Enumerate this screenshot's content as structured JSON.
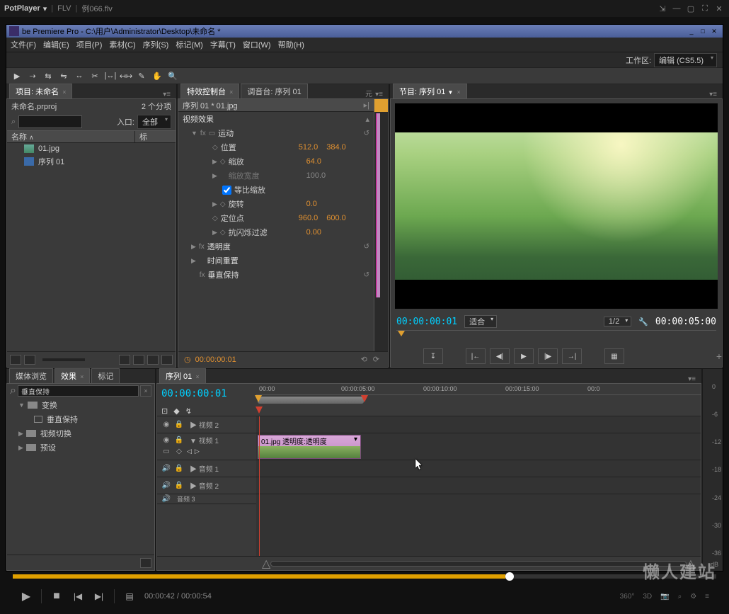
{
  "potplayer": {
    "app": "PotPlayer",
    "dropdown_glyph": "▾",
    "format": "FLV",
    "filename": "例066.flv",
    "controls": {
      "current_time": "00:00:42",
      "duration": "00:00:54",
      "small_360": "360°",
      "small_3d": "3D"
    }
  },
  "premiere": {
    "title": "be Premiere Pro - C:\\用户\\Administrator\\Desktop\\未命名 *",
    "menus": [
      "文件(F)",
      "编辑(E)",
      "项目(P)",
      "素材(C)",
      "序列(S)",
      "标记(M)",
      "字幕(T)",
      "窗口(W)",
      "帮助(H)"
    ],
    "workspace_label": "工作区:",
    "workspace_value": "编辑 (CS5.5)"
  },
  "project": {
    "tab": "项目: 未命名",
    "file": "未命名.prproj",
    "count": "2 个分项",
    "in_label": "入口:",
    "in_value": "全部",
    "cols": {
      "name": "名称",
      "label": "标"
    },
    "sort_glyph": "∧",
    "items": [
      {
        "name": "01.jpg"
      },
      {
        "name": "序列 01"
      }
    ]
  },
  "effect_controls": {
    "tabs": [
      "特效控制台",
      "调音台: 序列 01"
    ],
    "meta": "元",
    "source_clip": "序列 01 * 01.jpg",
    "section_video": "视频效果",
    "groups": {
      "motion": {
        "label": "运动",
        "position": {
          "label": "位置",
          "x": "512.0",
          "y": "384.0"
        },
        "scale": {
          "label": "缩放",
          "value": "64.0"
        },
        "scale_width": {
          "label": "缩放宽度",
          "value": "100.0"
        },
        "uniform": {
          "label": "等比缩放",
          "checked": true
        },
        "rotation": {
          "label": "旋转",
          "value": "0.0"
        },
        "anchor": {
          "label": "定位点",
          "x": "960.0",
          "y": "600.0"
        },
        "antiflicker": {
          "label": "抗闪烁过滤",
          "value": "0.00"
        }
      },
      "opacity": "透明度",
      "time_remap": "时间重置",
      "vertical_hold": "垂直保持"
    },
    "footer_time": "00:00:00:01"
  },
  "program": {
    "tab": "节目: 序列 01",
    "time_current": "00:00:00:01",
    "fit": "适合",
    "resolution": "1/2",
    "time_duration": "00:00:05:00"
  },
  "bottom_tabs": [
    "媒体浏览",
    "效果",
    "标记"
  ],
  "effects_panel": {
    "search": "垂直保持",
    "tree": [
      {
        "type": "folder",
        "level": 1,
        "name": "变换",
        "expanded": true
      },
      {
        "type": "effect",
        "level": 2,
        "name": "垂直保持"
      },
      {
        "type": "folder",
        "level": 1,
        "name": "视频切换",
        "expanded": false
      },
      {
        "type": "folder",
        "level": 1,
        "name": "预设",
        "expanded": false
      }
    ]
  },
  "timeline": {
    "tab": "序列 01",
    "time": "00:00:00:01",
    "ruler": [
      "00:00",
      "00:00:05:00",
      "00:00:10:00",
      "00:00:15:00",
      "00:0"
    ],
    "tracks": {
      "v2": "视频 2",
      "v1": "视频 1",
      "a1": "音频 1",
      "a2": "音频 2",
      "a3": "音频 3"
    },
    "clip_name": "01.jpg",
    "clip_effect": "透明度:透明度"
  },
  "meters": {
    "scale": [
      "0",
      "-6",
      "-12",
      "-18",
      "-24",
      "-30",
      "-36"
    ],
    "unit": "dB"
  },
  "watermark": "懒人建站"
}
